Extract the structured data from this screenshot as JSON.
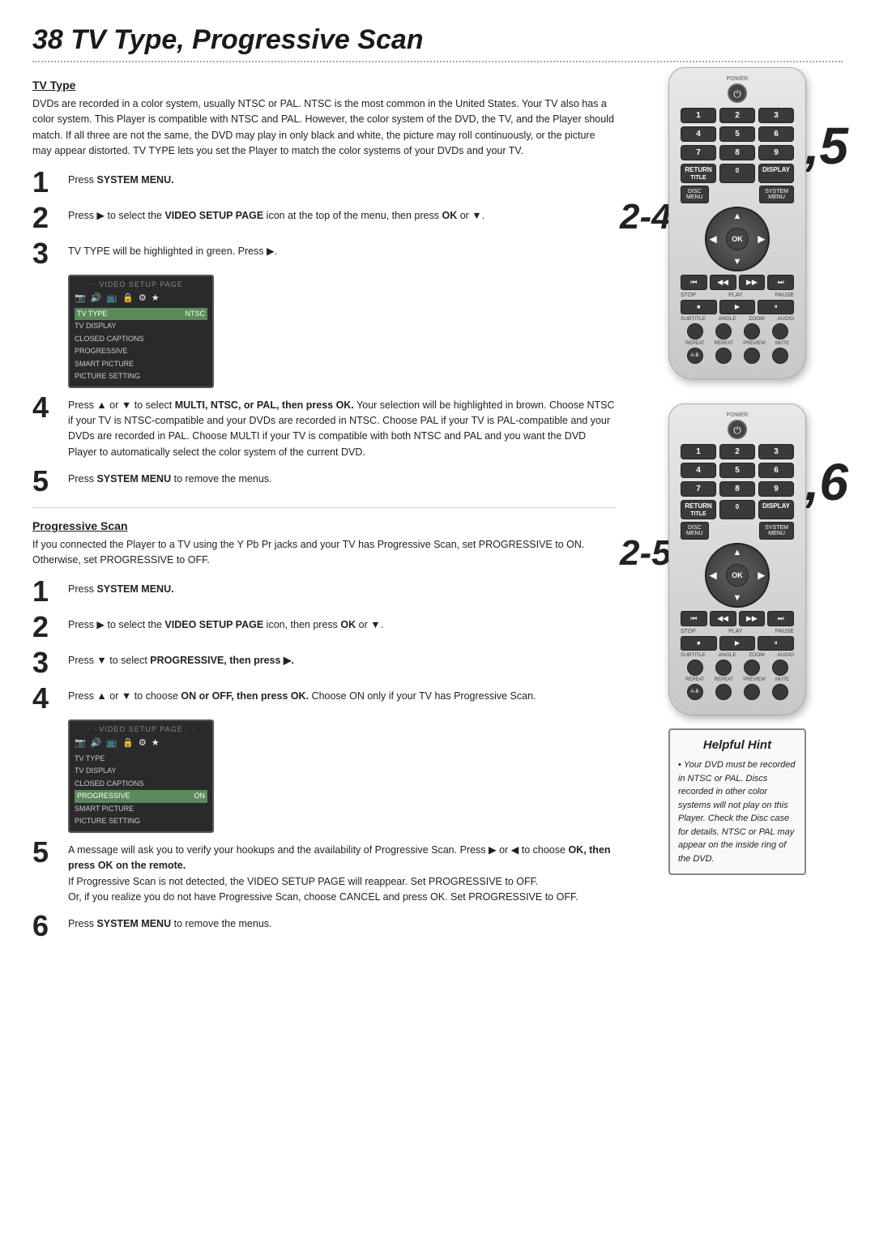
{
  "page": {
    "title": "38  TV Type, Progressive Scan",
    "section1": {
      "title": "TV Type",
      "body": "DVDs are recorded in a color system, usually NTSC or PAL. NTSC is the most common in the United States. Your TV also has a color system. This Player is compatible with NTSC and PAL. However, the color system of the DVD, the TV, and the Player should match. If all three are not the same, the DVD may play in only black and white, the picture may roll continuously, or the picture may appear distorted. TV TYPE lets you set the Player to match the color systems of your DVDs and your TV.",
      "steps": [
        {
          "num": "1",
          "text": "Press <b>SYSTEM MENU.</b>"
        },
        {
          "num": "2",
          "text": "Press ▶ to select the <b>VIDEO SETUP PAGE</b> icon at the top of the menu, then press <b>OK</b> or ▼."
        },
        {
          "num": "3",
          "text": "TV TYPE will be highlighted in green. Press ▶."
        },
        {
          "num": "4",
          "text": "Press ▲ or ▼ to select <b>MULTI, NTSC, or PAL, then press OK.</b> Your selection will be highlighted in brown. Choose NTSC if your TV is NTSC-compatible and your DVDs are recorded in NTSC. Choose PAL if your TV is PAL-compatible and your DVDs are recorded in PAL. Choose MULTI if your TV is compatible with both NTSC and PAL and you want the DVD Player to automatically select the color system of the current DVD."
        },
        {
          "num": "5",
          "text": "Press <b>SYSTEM MENU</b> to remove the menus."
        }
      ],
      "bigLabel1": "1,5",
      "bigLabel2": "2-4"
    },
    "section2": {
      "title": "Progressive Scan",
      "body": "If you connected the Player to a TV using the Y Pb Pr jacks and your TV has Progressive Scan, set PROGRESSIVE to ON. Otherwise, set PROGRESSIVE to OFF.",
      "steps": [
        {
          "num": "1",
          "text": "Press <b>SYSTEM MENU.</b>"
        },
        {
          "num": "2",
          "text": "Press ▶ to select the <b>VIDEO SETUP PAGE</b> icon, then press <b>OK</b> or ▼."
        },
        {
          "num": "3",
          "text": "Press ▼ to select <b>PROGRESSIVE, then press ▶.</b>"
        },
        {
          "num": "4",
          "text": "Press ▲ or ▼ to choose <b>ON or OFF, then press OK.</b> Choose ON only if your TV has Progressive Scan."
        },
        {
          "num": "5",
          "text_main": "A message will ask you to verify your hookups and the availability of Progressive Scan. Press ▶ or ◀ to choose <b>OK, then press OK on the remote.</b> If Progressive Scan is not detected, the VIDEO SETUP PAGE will reappear. Set PROGRESSIVE to OFF. Or, if you realize you do not have Progressive Scan, choose CANCEL and press OK. Set PROGRESSIVE to OFF."
        },
        {
          "num": "6",
          "text": "Press <b>SYSTEM MENU</b> to remove the menus."
        }
      ],
      "bigLabel1": "1,6",
      "bigLabel2": "2-5"
    },
    "hintBox": {
      "title": "Helpful Hint",
      "bullet": "Your DVD must be recorded in NTSC or PAL. Discs recorded in other color systems will not play on this Player. Check the Disc case for details. NTSC or PAL may appear on the inside ring of the DVD."
    },
    "remote": {
      "power_label": "POWER",
      "buttons": {
        "nums": [
          "1",
          "2",
          "3",
          "4",
          "5",
          "6",
          "7",
          "8",
          "9"
        ],
        "return": "RETURN",
        "title": "TITLE",
        "zero": "0",
        "display": "DISPLAY",
        "disc_menu": "DISC\nMENU",
        "system_menu": "SYSTEM\nMENU",
        "ok": "OK",
        "stop_label": "STOP",
        "play_label": "PLAY",
        "pause_label": "PAUSE",
        "subtitle": "SUBTITLE",
        "angle": "ANGLE",
        "zoom": "ZOOM",
        "audio": "AUDIO",
        "repeat1": "REPEAT",
        "repeat2": "REPEAT",
        "preview": "PREVIEW",
        "mute": "MUTE",
        "ab": "A-B"
      }
    }
  }
}
